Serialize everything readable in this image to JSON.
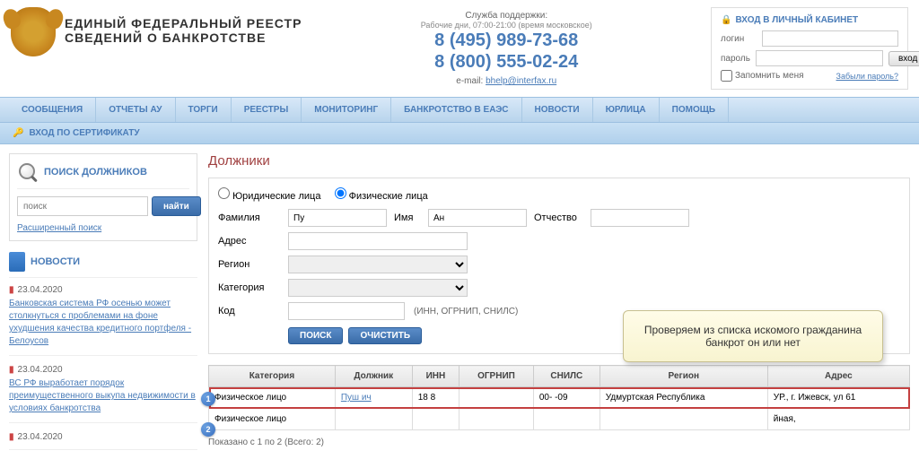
{
  "header": {
    "title_line1": "ЕДИНЫЙ  ФЕДЕРАЛЬНЫЙ  РЕЕСТР",
    "title_line2": "СВЕДЕНИЙ О БАНКРОТСТВЕ",
    "support_label": "Служба поддержки:",
    "support_hours": "Рабочие дни, 07:00-21:00 (время московское)",
    "phone1": "8 (495) 989-73-68",
    "phone2": "8 (800) 555-02-24",
    "email_prefix": "e-mail: ",
    "email": "bhelp@interfax.ru"
  },
  "login": {
    "title": "ВХОД В ЛИЧНЫЙ КАБИНЕТ",
    "login_label": "логин",
    "password_label": "пароль",
    "button": "вход",
    "remember": "Запомнить меня",
    "forgot": "Забыли пароль?"
  },
  "nav": [
    "СООБЩЕНИЯ",
    "ОТЧЕТЫ АУ",
    "ТОРГИ",
    "РЕЕСТРЫ",
    "МОНИТОРИНГ",
    "БАНКРОТСТВО В ЕАЭС",
    "НОВОСТИ",
    "ЮРЛИЦА",
    "ПОМОЩЬ"
  ],
  "subnav": "ВХОД ПО СЕРТИФИКАТУ",
  "sidebar": {
    "search_title": "ПОИСК ДОЛЖНИКОВ",
    "search_placeholder": "поиск",
    "search_button": "найти",
    "adv_search": "Расширенный поиск",
    "news_title": "НОВОСТИ",
    "news": [
      {
        "date": "23.04.2020",
        "text": "Банковская система РФ осенью может столкнуться с проблемами на фоне ухудшения качества кредитного портфеля - Белоусов"
      },
      {
        "date": "23.04.2020",
        "text": "ВС РФ выработает порядок преимущественного выкупа недвижимости в условиях банкротства"
      },
      {
        "date": "23.04.2020",
        "text": ""
      }
    ]
  },
  "main": {
    "title": "Должники",
    "radio_legal": "Юридические лица",
    "radio_person": "Физические лица",
    "labels": {
      "lastname": "Фамилия",
      "firstname": "Имя",
      "patronymic": "Отчество",
      "address": "Адрес",
      "region": "Регион",
      "category": "Категория",
      "code": "Код"
    },
    "values": {
      "lastname": "Пу",
      "firstname": "Ан"
    },
    "code_hint": "(ИНН, ОГРНИП, СНИЛС)",
    "btn_search": "ПОИСК",
    "btn_clear": "ОЧИСТИТЬ",
    "columns": [
      "Категория",
      "Должник",
      "ИНН",
      "ОГРНИП",
      "СНИЛС",
      "Регион",
      "Адрес"
    ],
    "rows": [
      {
        "badge": "1",
        "category": "Физическое лицо",
        "debtor": "Пуш                       ич",
        "inn": "18               8",
        "ogrnip": "",
        "snils": "   00-     -09",
        "region": "Удмуртская Республика",
        "address": "УР., г. Ижевск, ул 61"
      },
      {
        "badge": "2",
        "category": "Физическое лицо",
        "debtor": " ",
        "inn": " ",
        "ogrnip": " ",
        "snils": " ",
        "region": " ",
        "address": "йная,"
      }
    ],
    "pager": "Показано с 1 по 2 (Всего: 2)",
    "callout": "Проверяем из списка искомого гражданина банкрот он или нет"
  }
}
